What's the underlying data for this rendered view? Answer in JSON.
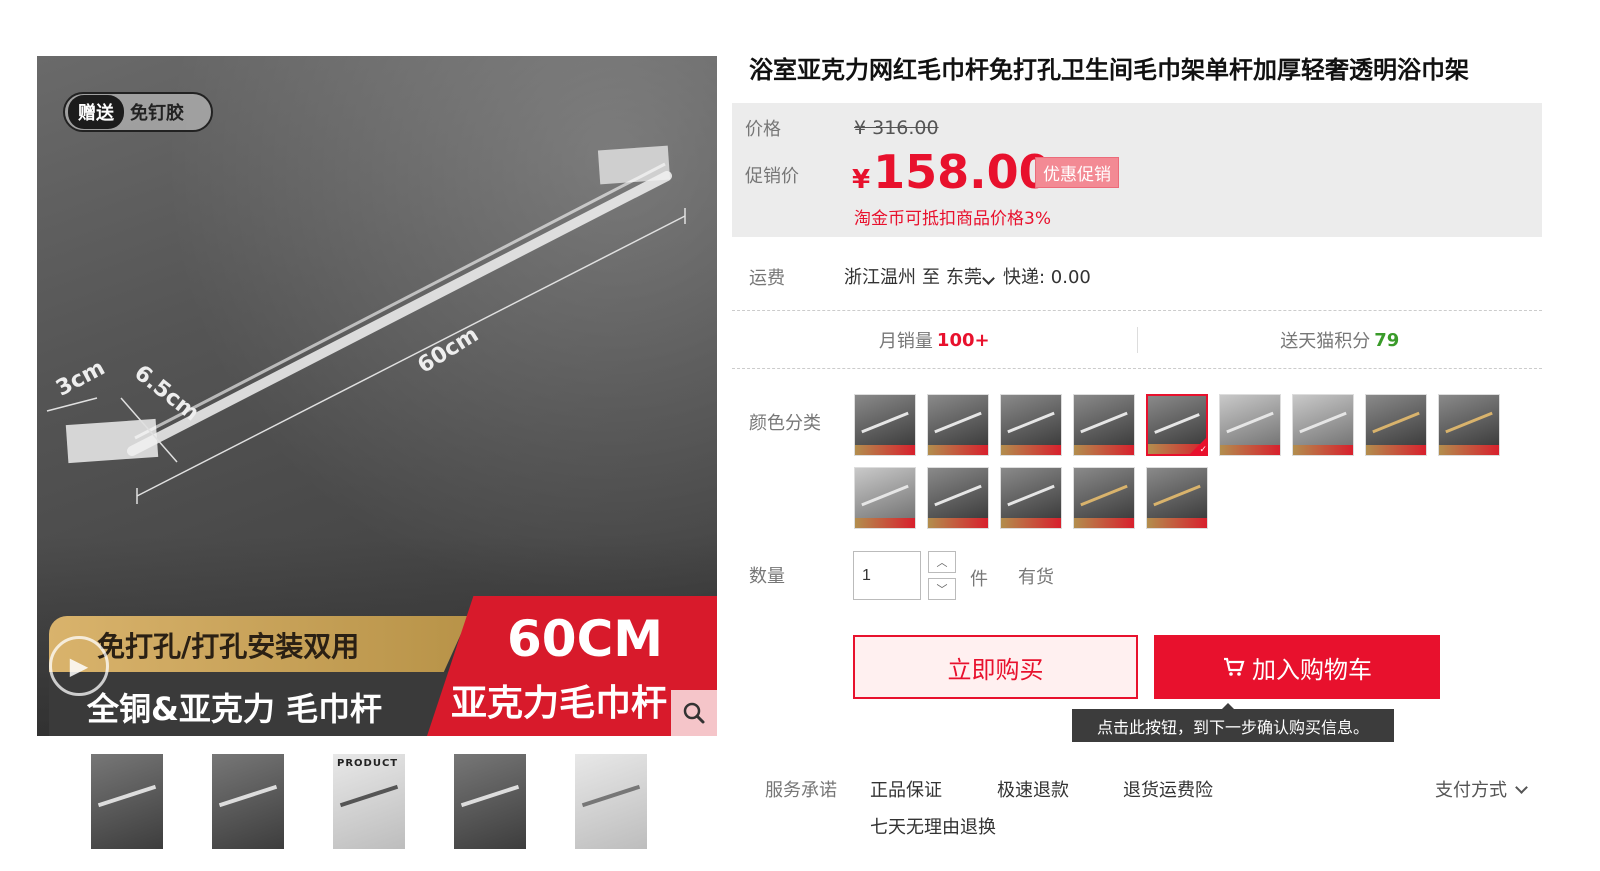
{
  "gallery": {
    "gift_tag": "赠送",
    "gift_text": "免钉胶",
    "dim_a": "3cm",
    "dim_b": "6.5cm",
    "dim_c": "60cm",
    "banner_gold": "免打孔/打孔安装双用",
    "banner_dark": "全铜&亚克力 毛巾杆",
    "banner_size": "60CM",
    "banner_name": "亚克力毛巾杆",
    "thumb_label": "PRODUCT"
  },
  "product": {
    "title": "浴室亚克力网红毛巾杆免打孔卫生间毛巾架单杆加厚轻奢透明浴巾架"
  },
  "price": {
    "orig_label": "价格",
    "orig_value": "¥ 316.00",
    "promo_label": "促销价",
    "currency": "¥",
    "promo_value": "158.00",
    "promo_tag": "优惠促销",
    "coin_note": "淘金币可抵扣商品价格3%"
  },
  "shipping": {
    "label": "运费",
    "from": "浙江温州",
    "to_word": "至",
    "to": "东莞",
    "method": "快递: 0.00"
  },
  "stats": {
    "sales_label": "月销量",
    "sales_value": "100+",
    "points_label": "送天猫积分",
    "points_value": "79"
  },
  "options": {
    "color_label": "颜色分类",
    "swatch_count": 14,
    "selected_index": 4
  },
  "quantity": {
    "label": "数量",
    "value": "1",
    "unit": "件",
    "stock": "有货"
  },
  "actions": {
    "buy_now": "立即购买",
    "add_to_cart": "加入购物车",
    "tooltip": "点击此按钮，到下一步确认购买信息。"
  },
  "services": {
    "label": "服务承诺",
    "items": [
      "正品保证",
      "极速退款",
      "退货运费险",
      "七天无理由退换"
    ],
    "payment": "支付方式"
  },
  "colors": {
    "accent": "#e8112d",
    "points": "#3a9b2a"
  }
}
